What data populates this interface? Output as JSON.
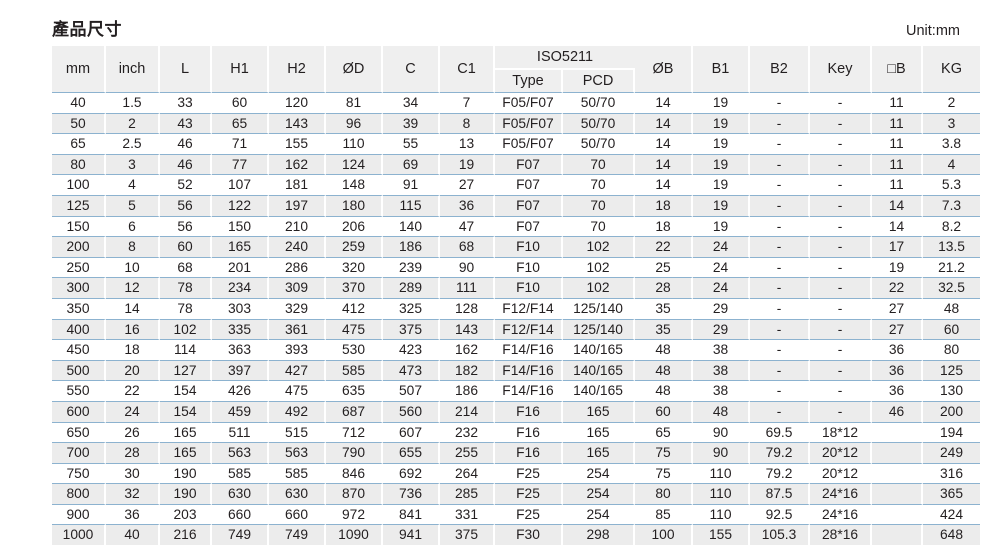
{
  "document": {
    "title": "產品尺寸",
    "unit_label": "Unit:mm"
  },
  "table": {
    "group_header": {
      "iso_label": "ISO5211"
    },
    "columns": [
      {
        "key": "mm",
        "label": "mm"
      },
      {
        "key": "inch",
        "label": "inch"
      },
      {
        "key": "L",
        "label": "L"
      },
      {
        "key": "H1",
        "label": "H1"
      },
      {
        "key": "H2",
        "label": "H2"
      },
      {
        "key": "OD",
        "label": "ØD"
      },
      {
        "key": "C",
        "label": "C"
      },
      {
        "key": "C1",
        "label": "C1"
      },
      {
        "key": "Type",
        "label": "Type"
      },
      {
        "key": "PCD",
        "label": "PCD"
      },
      {
        "key": "OB",
        "label": "ØB"
      },
      {
        "key": "B1",
        "label": "B1"
      },
      {
        "key": "B2",
        "label": "B2"
      },
      {
        "key": "Key",
        "label": "Key"
      },
      {
        "key": "SQB",
        "label": "□B"
      },
      {
        "key": "KG",
        "label": "KG"
      }
    ],
    "rows": [
      [
        "40",
        "1.5",
        "33",
        "60",
        "120",
        "81",
        "34",
        "7",
        "F05/F07",
        "50/70",
        "14",
        "19",
        "-",
        "-",
        "11",
        "2"
      ],
      [
        "50",
        "2",
        "43",
        "65",
        "143",
        "96",
        "39",
        "8",
        "F05/F07",
        "50/70",
        "14",
        "19",
        "-",
        "-",
        "11",
        "3"
      ],
      [
        "65",
        "2.5",
        "46",
        "71",
        "155",
        "110",
        "55",
        "13",
        "F05/F07",
        "50/70",
        "14",
        "19",
        "-",
        "-",
        "11",
        "3.8"
      ],
      [
        "80",
        "3",
        "46",
        "77",
        "162",
        "124",
        "69",
        "19",
        "F07",
        "70",
        "14",
        "19",
        "-",
        "-",
        "11",
        "4"
      ],
      [
        "100",
        "4",
        "52",
        "107",
        "181",
        "148",
        "91",
        "27",
        "F07",
        "70",
        "14",
        "19",
        "-",
        "-",
        "11",
        "5.3"
      ],
      [
        "125",
        "5",
        "56",
        "122",
        "197",
        "180",
        "115",
        "36",
        "F07",
        "70",
        "18",
        "19",
        "-",
        "-",
        "14",
        "7.3"
      ],
      [
        "150",
        "6",
        "56",
        "150",
        "210",
        "206",
        "140",
        "47",
        "F07",
        "70",
        "18",
        "19",
        "-",
        "-",
        "14",
        "8.2"
      ],
      [
        "200",
        "8",
        "60",
        "165",
        "240",
        "259",
        "186",
        "68",
        "F10",
        "102",
        "22",
        "24",
        "-",
        "-",
        "17",
        "13.5"
      ],
      [
        "250",
        "10",
        "68",
        "201",
        "286",
        "320",
        "239",
        "90",
        "F10",
        "102",
        "25",
        "24",
        "-",
        "-",
        "19",
        "21.2"
      ],
      [
        "300",
        "12",
        "78",
        "234",
        "309",
        "370",
        "289",
        "111",
        "F10",
        "102",
        "28",
        "24",
        "-",
        "-",
        "22",
        "32.5"
      ],
      [
        "350",
        "14",
        "78",
        "303",
        "329",
        "412",
        "325",
        "128",
        "F12/F14",
        "125/140",
        "35",
        "29",
        "-",
        "-",
        "27",
        "48"
      ],
      [
        "400",
        "16",
        "102",
        "335",
        "361",
        "475",
        "375",
        "143",
        "F12/F14",
        "125/140",
        "35",
        "29",
        "-",
        "-",
        "27",
        "60"
      ],
      [
        "450",
        "18",
        "114",
        "363",
        "393",
        "530",
        "423",
        "162",
        "F14/F16",
        "140/165",
        "48",
        "38",
        "-",
        "-",
        "36",
        "80"
      ],
      [
        "500",
        "20",
        "127",
        "397",
        "427",
        "585",
        "473",
        "182",
        "F14/F16",
        "140/165",
        "48",
        "38",
        "-",
        "-",
        "36",
        "125"
      ],
      [
        "550",
        "22",
        "154",
        "426",
        "475",
        "635",
        "507",
        "186",
        "F14/F16",
        "140/165",
        "48",
        "38",
        "-",
        "-",
        "36",
        "130"
      ],
      [
        "600",
        "24",
        "154",
        "459",
        "492",
        "687",
        "560",
        "214",
        "F16",
        "165",
        "60",
        "48",
        "-",
        "-",
        "46",
        "200"
      ],
      [
        "650",
        "26",
        "165",
        "511",
        "515",
        "712",
        "607",
        "232",
        "F16",
        "165",
        "65",
        "90",
        "69.5",
        "18*12",
        "",
        "194"
      ],
      [
        "700",
        "28",
        "165",
        "563",
        "563",
        "790",
        "655",
        "255",
        "F16",
        "165",
        "75",
        "90",
        "79.2",
        "20*12",
        "",
        "249"
      ],
      [
        "750",
        "30",
        "190",
        "585",
        "585",
        "846",
        "692",
        "264",
        "F25",
        "254",
        "75",
        "110",
        "79.2",
        "20*12",
        "",
        "316"
      ],
      [
        "800",
        "32",
        "190",
        "630",
        "630",
        "870",
        "736",
        "285",
        "F25",
        "254",
        "80",
        "110",
        "87.5",
        "24*16",
        "",
        "365"
      ],
      [
        "900",
        "36",
        "203",
        "660",
        "660",
        "972",
        "841",
        "331",
        "F25",
        "254",
        "85",
        "110",
        "92.5",
        "24*16",
        "",
        "424"
      ],
      [
        "1000",
        "40",
        "216",
        "749",
        "749",
        "1090",
        "941",
        "375",
        "F30",
        "298",
        "100",
        "155",
        "105.3",
        "28*16",
        "",
        "648"
      ]
    ]
  },
  "colors": {
    "header_background": "#efefef",
    "row_stripe": "#ececec",
    "row_base": "#ffffff",
    "row_divider": "#8cb2cf",
    "text": "#231f20"
  }
}
